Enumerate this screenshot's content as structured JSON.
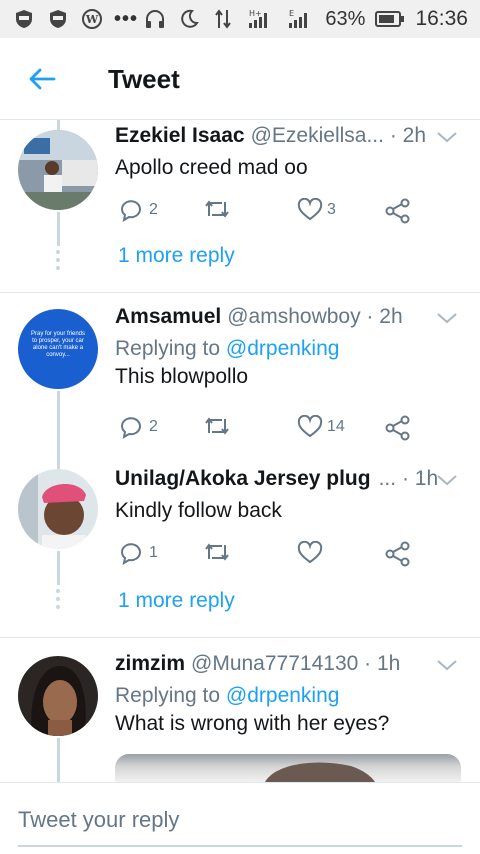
{
  "status_bar": {
    "battery": "63%",
    "time": "16:36",
    "network": "H+"
  },
  "header": {
    "title": "Tweet"
  },
  "tweets": [
    {
      "name": "Ezekiel Isaac",
      "handle": "@Ezekiellsa...",
      "time": "2h",
      "text": "Apollo creed mad oo",
      "replies": "2",
      "likes": "3",
      "more": "1 more reply"
    },
    {
      "name": "Amsamuel",
      "handle": "@amshowboy",
      "time": "2h",
      "replying_prefix": "Replying to",
      "replying_to": "@drpenking",
      "text": "This blowpollo",
      "replies": "2",
      "likes": "14",
      "avatar_text": "Pray for your friends to prosper, your car alone can't make a convoy..."
    },
    {
      "name": "Unilag/Akoka Jersey plug",
      "handle": "...",
      "time": "1h",
      "text": "Kindly follow back",
      "replies": "1",
      "likes": "",
      "more": "1 more reply"
    },
    {
      "name": "zimzim",
      "handle": "@Muna77714130",
      "time": "1h",
      "replying_prefix": "Replying to",
      "replying_to": "@drpenking",
      "text": "What is wrong with her eyes?"
    }
  ],
  "compose": {
    "placeholder": "Tweet your reply"
  },
  "colors": {
    "accent": "#1da1f2",
    "muted": "#657786",
    "text": "#14171a",
    "divider": "#e1e8ed"
  }
}
